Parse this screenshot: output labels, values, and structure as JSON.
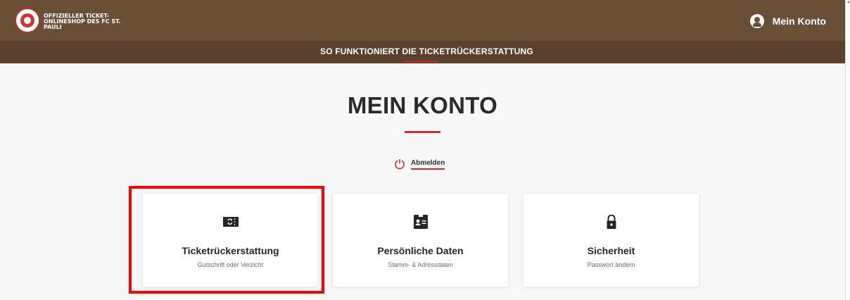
{
  "header": {
    "logo_text": "OFFIZIELLER TICKET-ONLINESHOP DES FC ST. PAULI",
    "account_label": "Mein Konto"
  },
  "subnav": {
    "link_label": "SO FUNKTIONIERT DIE TICKETRÜCKERSTATTUNG"
  },
  "main": {
    "title": "MEIN KONTO",
    "logout_label": "Abmelden",
    "cards": [
      {
        "title": "Ticketrückerstattung",
        "subtitle": "Gutschrift oder Verzicht",
        "icon": "ticket-refund-icon"
      },
      {
        "title": "Persönliche Daten",
        "subtitle": "Stamm- & Adressdaten",
        "icon": "id-card-icon"
      },
      {
        "title": "Sicherheit",
        "subtitle": "Passwort ändern",
        "icon": "lock-icon"
      }
    ]
  },
  "colors": {
    "topbar": "#6a4f37",
    "subnav": "#5b412c",
    "accent": "#d32b2d",
    "highlight": "#ff0000"
  }
}
